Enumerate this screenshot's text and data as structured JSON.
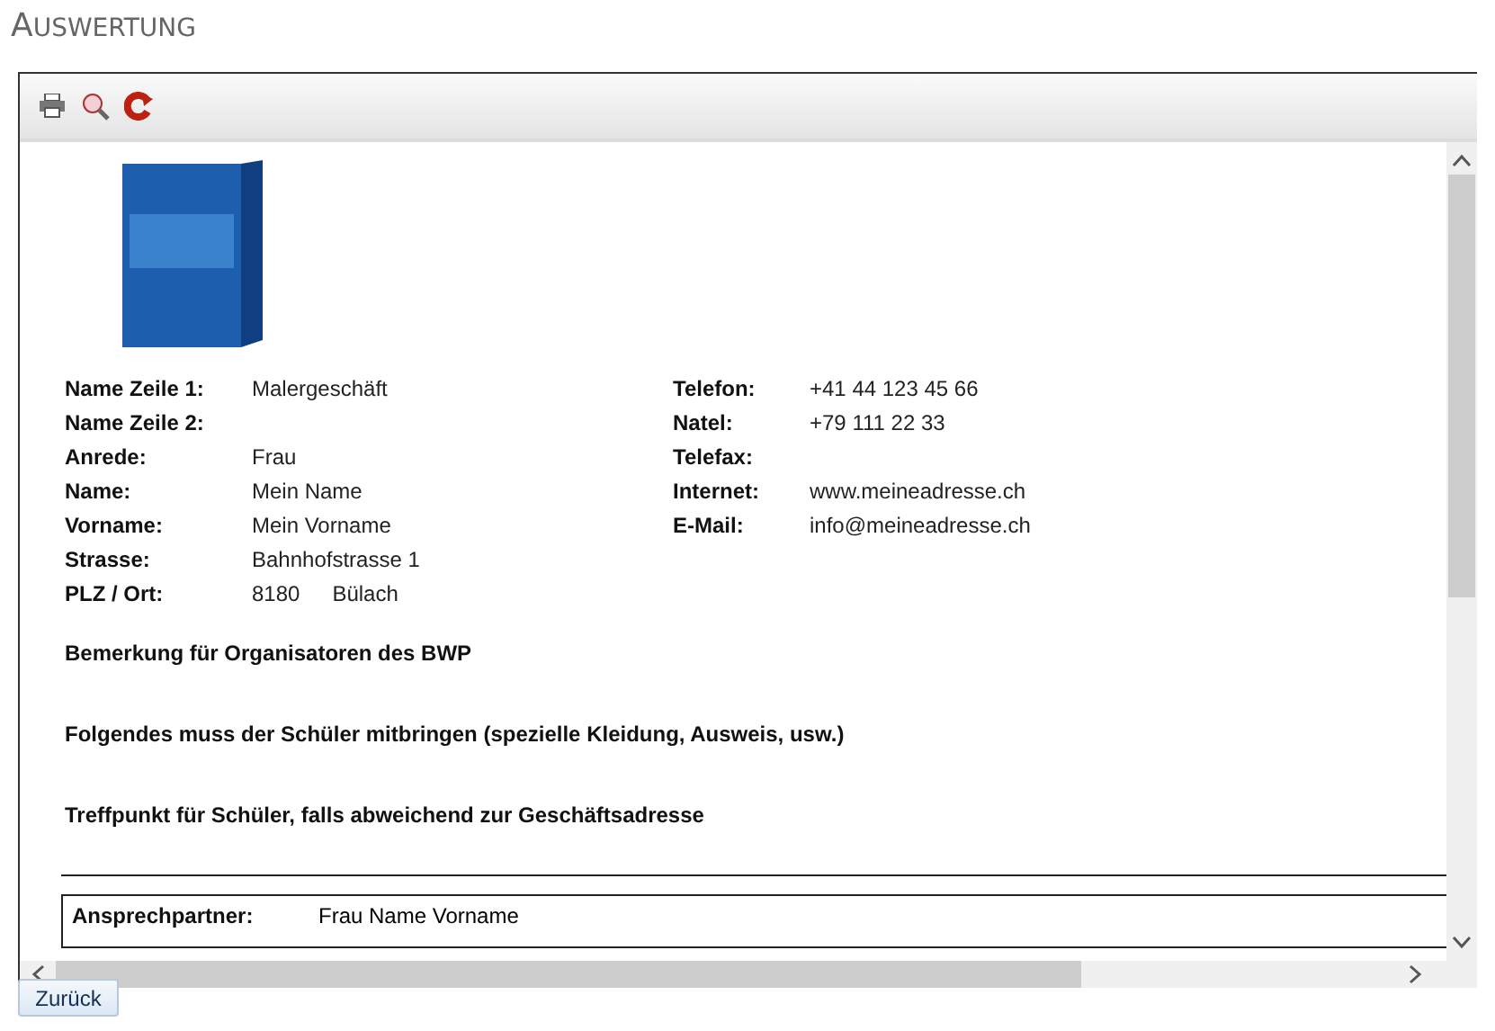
{
  "heading": "AUSWERTUNG",
  "toolbar": [
    {
      "kind": "print"
    },
    {
      "kind": "zoom"
    },
    {
      "kind": "refresh"
    }
  ],
  "left_fields": [
    {
      "label": "Name Zeile 1:",
      "value": "Malergeschäft"
    },
    {
      "label": "Name Zeile 2:"
    },
    {
      "label": "Anrede:",
      "value": "Frau"
    },
    {
      "label": "Name:",
      "value": "Mein Name"
    },
    {
      "label": "Vorname:",
      "value": "Mein Vorname"
    },
    {
      "label": "Strasse:",
      "value": "Bahnhofstrasse 1"
    },
    {
      "label": "PLZ / Ort:",
      "value": "8180",
      "value_2": "Bülach"
    }
  ],
  "right_fields": [
    {
      "label": "Telefon:",
      "value": "+41 44 123 45 66"
    },
    {
      "label": "Natel:",
      "value": "+79 111 22 33"
    },
    {
      "label": "Telefax:"
    },
    {
      "label": "Internet:",
      "value": "www.meineadresse.ch"
    },
    {
      "label": "E-Mail:",
      "value": "info@meineadresse.ch"
    }
  ],
  "sections": [
    "Bemerkung für Organisatoren des BWP",
    "Folgendes muss der Schüler mitbringen (spezielle Kleidung, Ausweis, usw.)",
    "Treffpunkt für Schüler, falls abweichend zur Geschäftsadresse"
  ],
  "contact": {
    "label": "Ansprechpartner:",
    "value": "Frau Name Vorname"
  },
  "back_button": "Zurück"
}
